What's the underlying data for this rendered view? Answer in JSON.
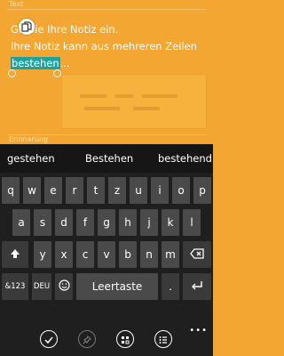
{
  "note": {
    "field_label": "Text",
    "line1_start": "G",
    "line1_rest": "n Sie Ihre Notiz ein.",
    "line2": "Ihre Notiz kann aus mehreren Zeilen",
    "line3_selected": "bestehen",
    "line3_rest": "..."
  },
  "reminder": {
    "label": "Erinnerung"
  },
  "suggestions": [
    "gestehen",
    "Bestehen",
    "bestehend"
  ],
  "keyboard": {
    "row1": [
      "q",
      "w",
      "e",
      "r",
      "t",
      "z",
      "u",
      "i",
      "o",
      "p"
    ],
    "row2": [
      "a",
      "s",
      "d",
      "f",
      "g",
      "h",
      "j",
      "k",
      "l"
    ],
    "row3": [
      "y",
      "x",
      "c",
      "v",
      "b",
      "n",
      "m"
    ],
    "numbers_key": "&123",
    "lang_key": "DEU",
    "space_key": "Leertaste",
    "period_key": "."
  },
  "icons": {
    "copy": "copy-icon",
    "shift": "shift-icon",
    "backspace": "backspace-icon",
    "emoji": "emoji-icon",
    "enter": "enter-icon",
    "save": "check-icon",
    "pin": "pin-icon",
    "color": "palette-icon",
    "list": "list-icon"
  },
  "colors": {
    "note_background": "#f4a632",
    "selection": "#1ba3a0",
    "keyboard_background": "#1f1f1f",
    "key": "#4a4a4a"
  }
}
